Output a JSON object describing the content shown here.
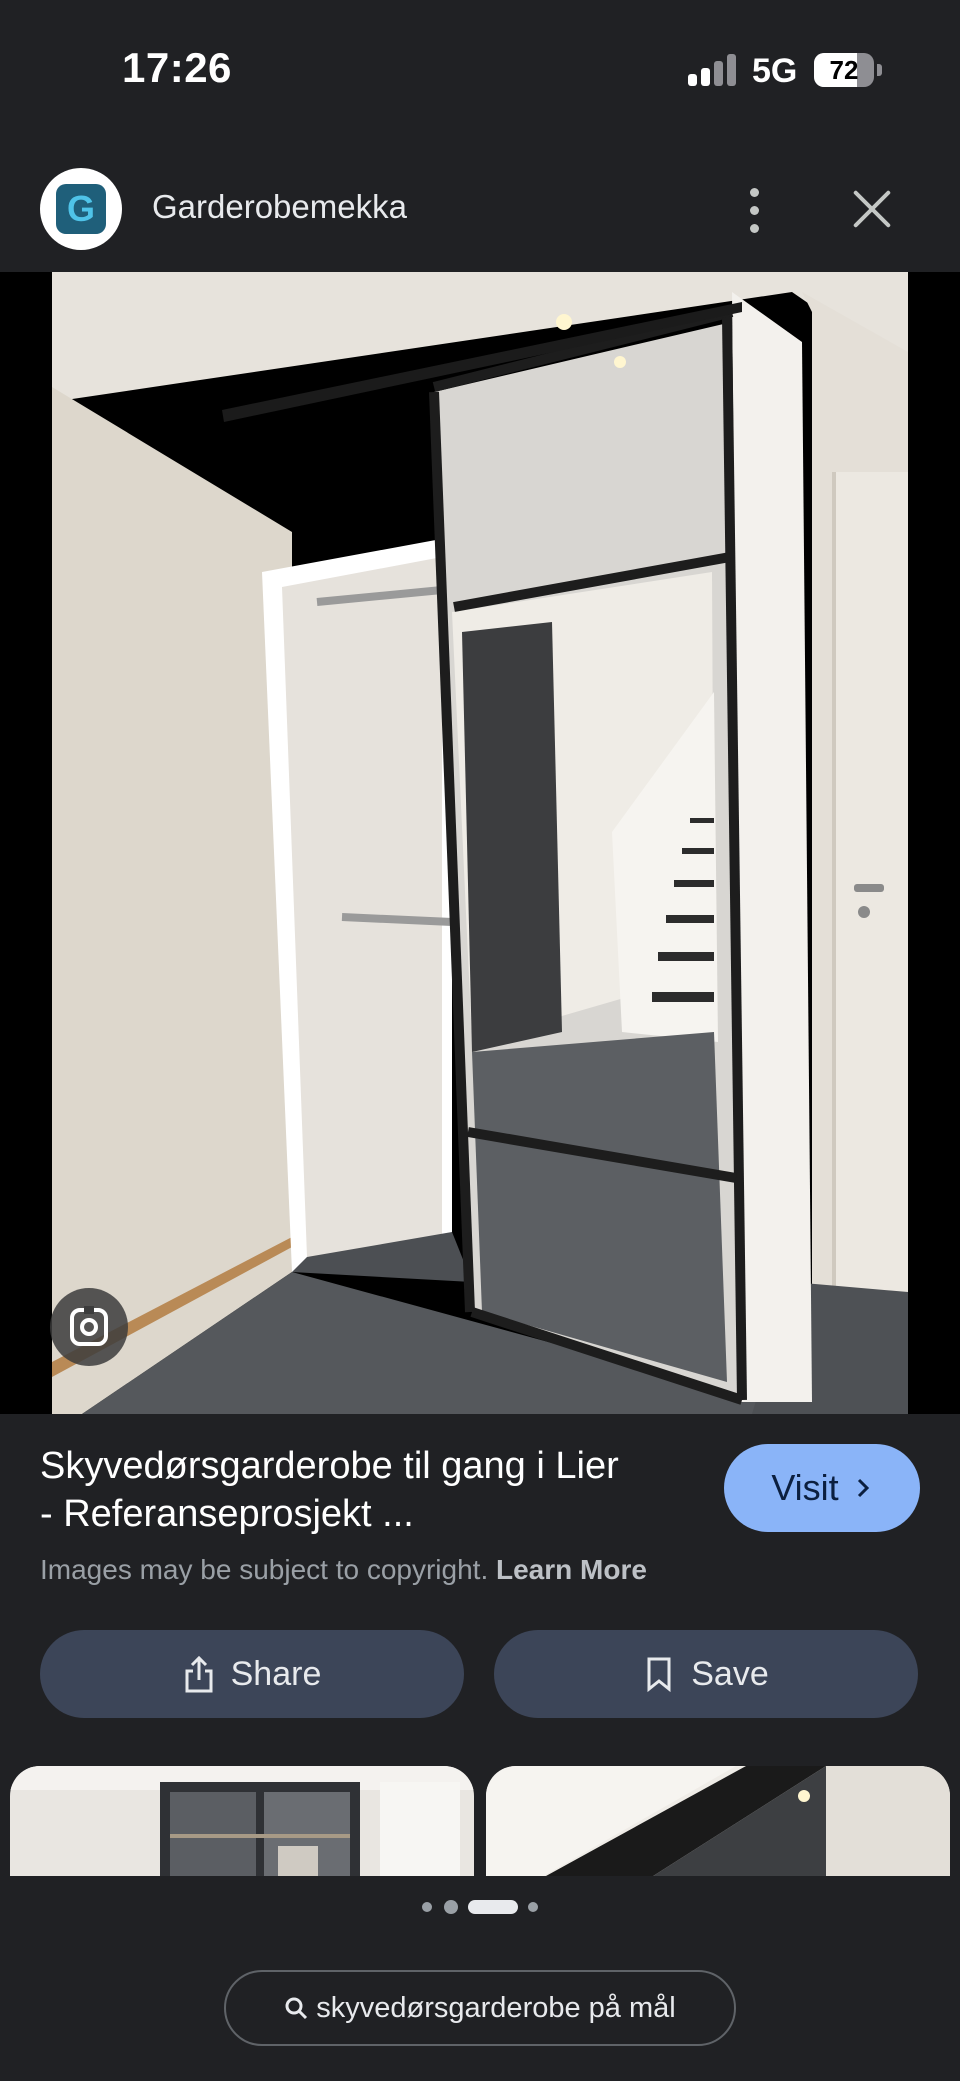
{
  "status_bar": {
    "time": "17:26",
    "network": "5G",
    "battery_level": "72",
    "signal_bars_active": 2,
    "signal_bars_total": 4
  },
  "source": {
    "favicon_letter": "G",
    "name": "Garderobemekka",
    "more_icon": "more-vert-icon",
    "close_icon": "close-icon"
  },
  "image": {
    "lens_icon": "lens-icon"
  },
  "result": {
    "title_line1": "Skyvedørsgarderobe til gang i Lier",
    "title_line2": "- Referanseprosjekt ...",
    "visit_label": "Visit",
    "copyright_text": "Images may be subject to copyright.",
    "learn_more_label": "Learn More"
  },
  "actions": {
    "share_label": "Share",
    "save_label": "Save"
  },
  "pager": {
    "active_index": 2,
    "count": 4
  },
  "search_chip": {
    "label": "skyvedørsgarderobe på mål"
  },
  "colors": {
    "background": "#202124",
    "visit_button": "#8ab4f8",
    "action_button": "#3c4558"
  }
}
